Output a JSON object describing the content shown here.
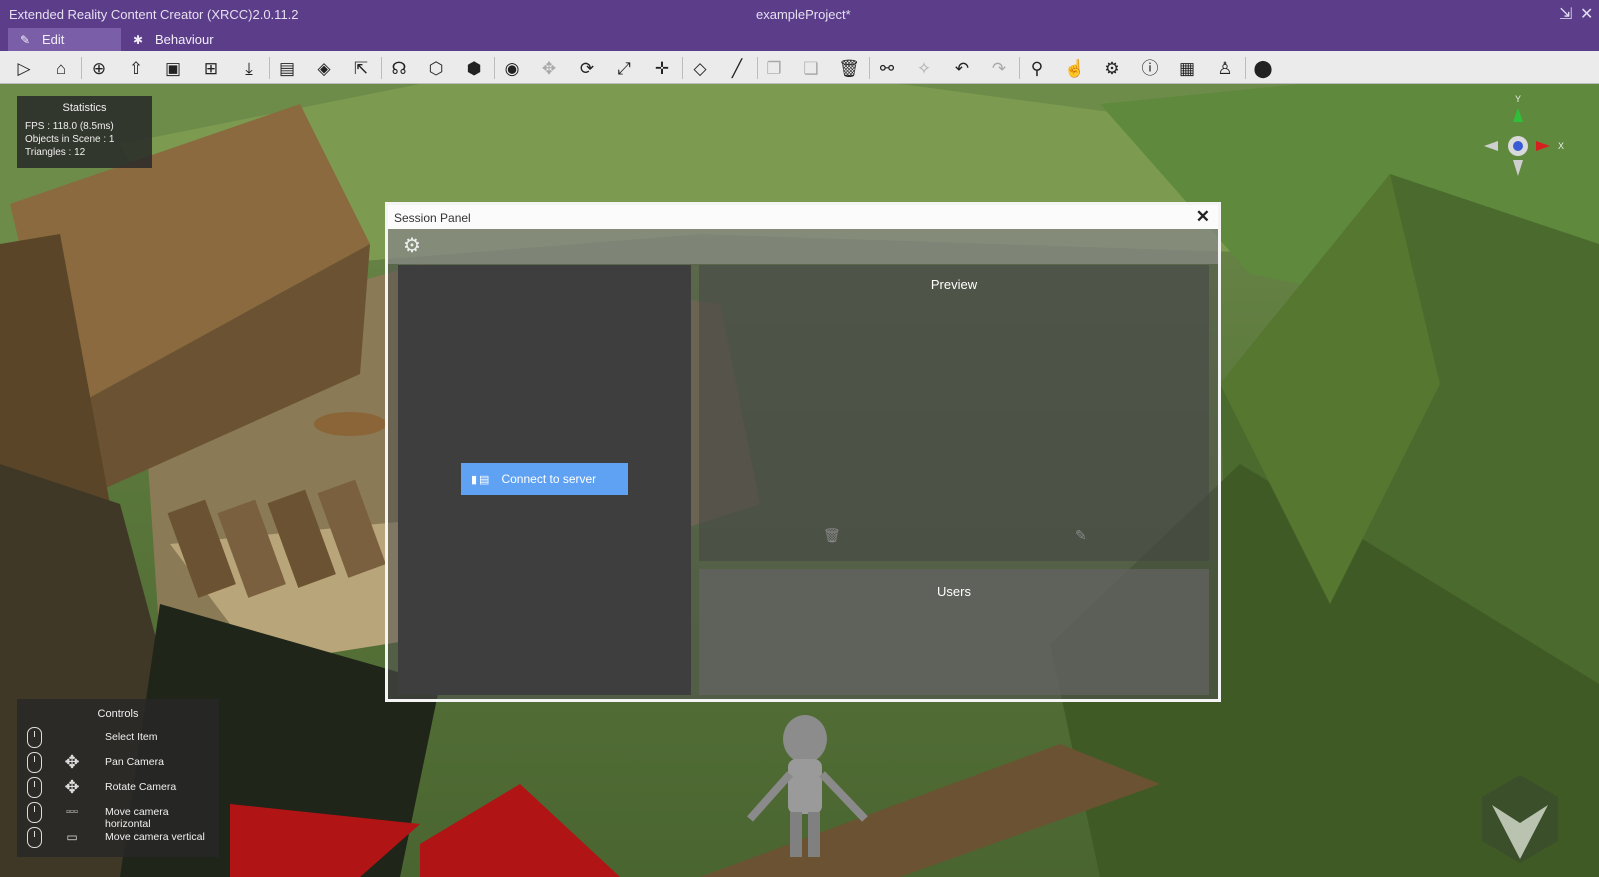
{
  "titlebar": {
    "app_title": "Extended Reality Content Creator (XRCC)2.0.11.2",
    "project_title": "exampleProject*",
    "restore_icon": "restore-icon",
    "close_icon": "close-icon"
  },
  "tabs": [
    {
      "label": "Edit",
      "icon": "edit-icon",
      "active": true
    },
    {
      "label": "Behaviour",
      "icon": "gear-icon",
      "active": false
    }
  ],
  "toolbar": {
    "icons": [
      "play-icon",
      "home-icon",
      "new-project-icon",
      "open-project-icon",
      "save-icon",
      "save-as-icon",
      "import-icon",
      "model-library-icon",
      "scene-icon",
      "export-icon",
      "voice-icon",
      "cube-outline-icon",
      "add-cube-icon",
      "visibility-icon",
      "move-icon",
      "rotate-icon",
      "scale-icon",
      "transform-icon",
      "object-icon",
      "line-icon",
      "copy-icon",
      "paste-icon",
      "delete-icon",
      "link-icon",
      "unlink-icon",
      "undo-icon",
      "redo-icon",
      "share-icon",
      "interaction-icon",
      "settings-icon",
      "info-icon",
      "session-icon",
      "avatar-icon",
      "unity-icon"
    ]
  },
  "statistics": {
    "title": "Statistics",
    "fps": "FPS : 118.0 (8.5ms)",
    "objects": "Objects in Scene : 1",
    "triangles": "Triangles : 12"
  },
  "gizmo": {
    "y_label": "Y",
    "x_label": "X",
    "colors": {
      "x": "#d62020",
      "y": "#2fbf3a",
      "z": "#3a5bd6"
    }
  },
  "controls": {
    "title": "Controls",
    "items": [
      {
        "label": "Select Item",
        "key_icon": ""
      },
      {
        "label": "Pan Camera",
        "key_icon": "move-arrows-icon"
      },
      {
        "label": "Rotate Camera",
        "key_icon": "move-arrows-icon"
      },
      {
        "label": "Move camera horizontal",
        "key_icon": "wasd-keys-icon"
      },
      {
        "label": "Move camera vertical",
        "key_icon": "space-key-icon"
      }
    ]
  },
  "session_panel": {
    "title": "Session Panel",
    "close_symbol": "✕",
    "connect_label": "Connect to server",
    "preview_title": "Preview",
    "users_title": "Users",
    "accent": "#5fa1f2"
  }
}
